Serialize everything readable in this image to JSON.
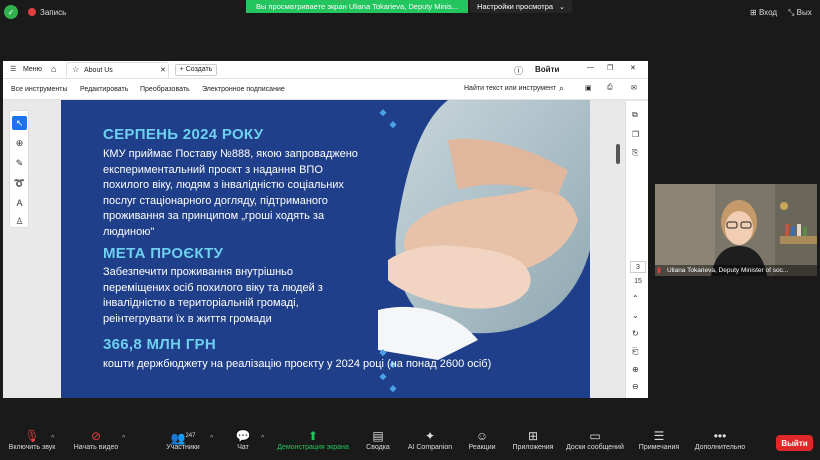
{
  "zoom_top": {
    "recording_label": "Запись",
    "share_banner": "Вы просматриваете экран Uliana Tokarieva, Deputy Minis...",
    "view_settings": "Настройки просмотра",
    "enter": "Вход",
    "exit_full": "Вых"
  },
  "viewer": {
    "menu": "Меню",
    "tab_title": "About Us",
    "create": "Создать",
    "login": "Войти",
    "toolbar": {
      "all_tools": "Все инструменты",
      "edit": "Редактировать",
      "convert": "Преобразовать",
      "esign": "Электронное подписание",
      "find": "Найти текст или инструмент"
    },
    "page_current": "3",
    "page_total": "15"
  },
  "slide": {
    "h1": "СЕРПЕНЬ 2024 РОКУ",
    "p1": [
      "КМУ приймає Поставу №888, якою запроваджено",
      "експериментальний проєкт з надання ВПО",
      "похилого віку, людям з інвалідністю соціальних",
      "послуг стаціонарного догляду, підтриманого",
      "проживання за принципом „гроші ходять за",
      "людиною\""
    ],
    "h2": "МЕТА ПРОЄКТУ",
    "p2": [
      "Забезпечити проживання внутрішньо",
      "переміщених осіб похилого віку та людей з",
      "інвалідністю в територіальній громаді,",
      "реінтегрувати їх в життя громади"
    ],
    "h3": "366,8 МЛН ГРН",
    "p3": "кошти держбюджету на реалізацію проєкту у 2024 році (на понад 2600 осіб)"
  },
  "participant": {
    "name": "Uliana Tokarieva, Deputy Minister of soc..."
  },
  "bottombar": {
    "mute": "Включить звук",
    "video": "Начать видео",
    "participants": "Участники",
    "participants_count": "247",
    "chat": "Чат",
    "share": "Демонстрация экрана",
    "summary": "Сводка",
    "ai": "AI Companion",
    "reactions": "Реакции",
    "apps": "Приложения",
    "whiteboards": "Доски сообщений",
    "notes": "Примечания",
    "more": "Дополнительно",
    "leave": "Выйти"
  },
  "colors": {
    "slide_bg": "#1f3f8a",
    "heading": "#6ed0f0",
    "zoom_green": "#23c55e",
    "leave_red": "#e02828"
  }
}
